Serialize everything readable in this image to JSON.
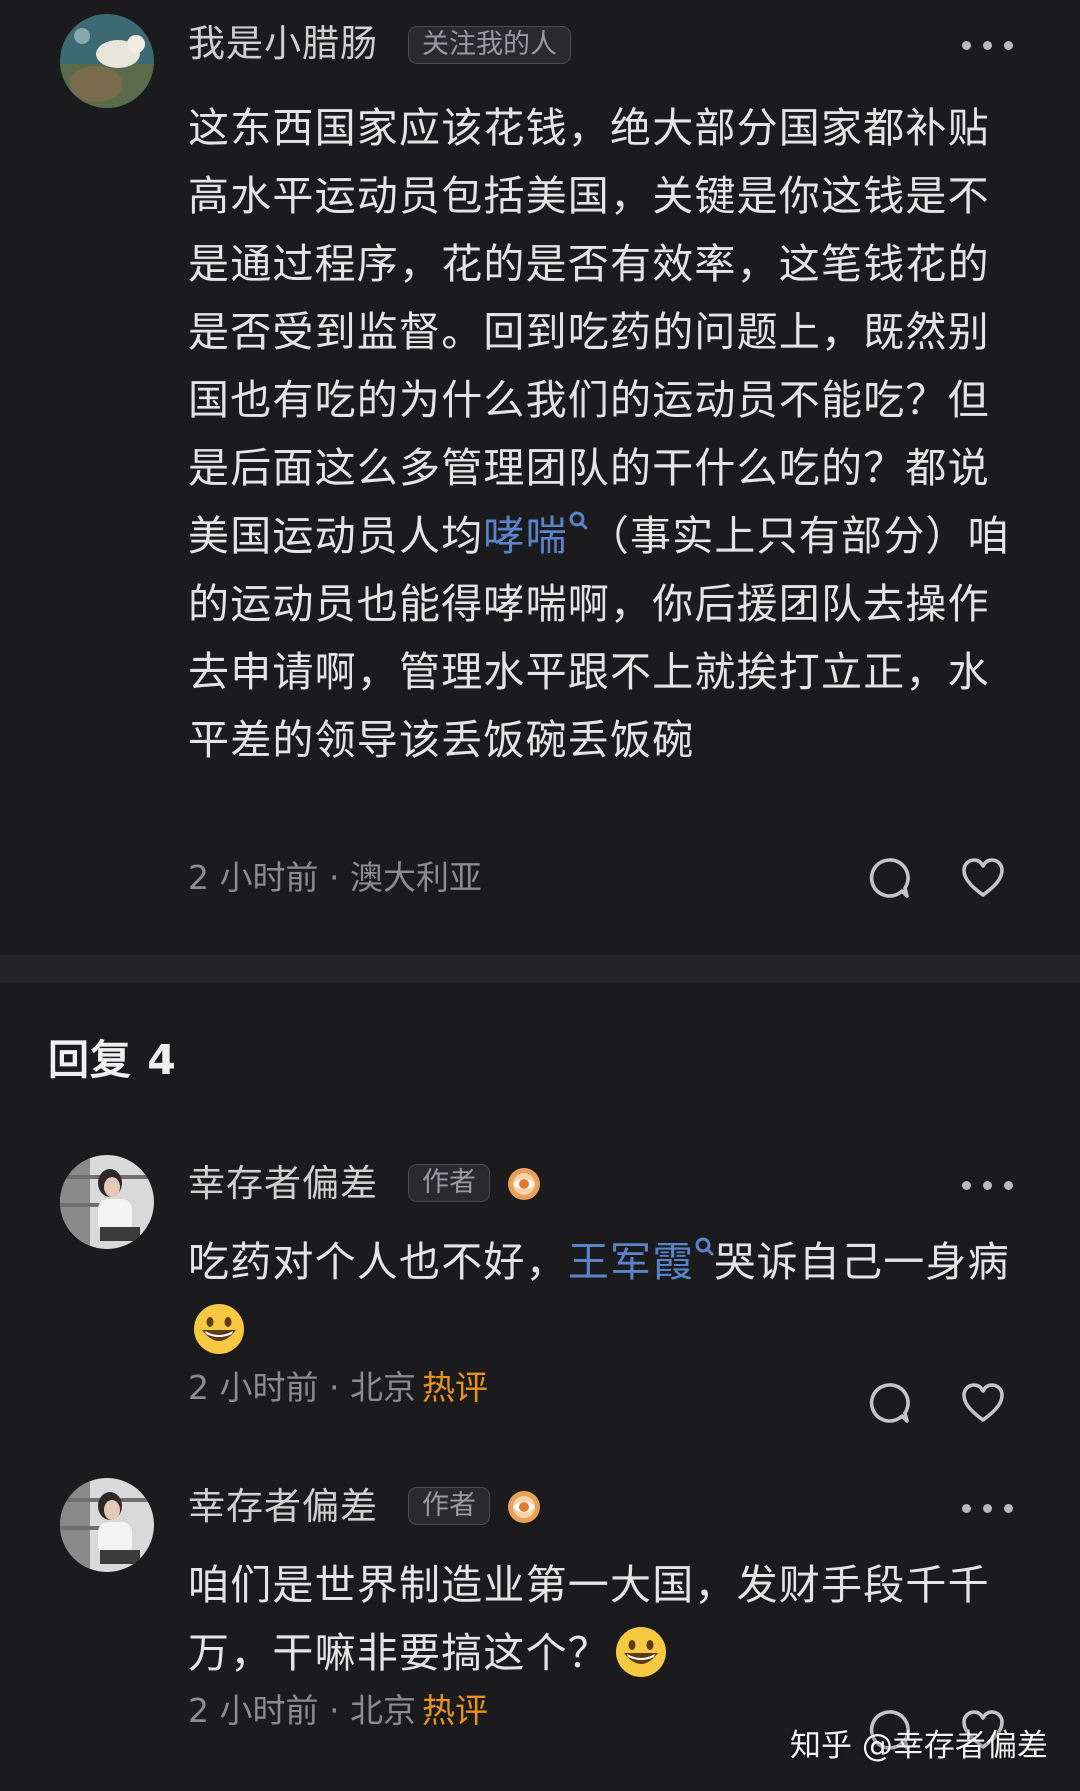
{
  "comments": [
    {
      "user": "我是小腊肠",
      "tag": "关注我的人",
      "body_pre": "这东西国家应该花钱，绝大部分国家都补贴高水平运动员包括美国，关键是你这钱是不是通过程序，花的是否有效率，这笔钱花的是否受到监督。回到吃药的问题上，既然别国也有吃的为什么我们的运动员不能吃？但是后面这么多管理团队的干什么吃的？都说美国运动员人均",
      "body_link": "哮喘",
      "body_post": "（事实上只有部分）咱的运动员也能得哮喘啊，你后援团队去操作去申请啊，管理水平跟不上就挨打立正，水平差的领导该丢饭碗丢饭碗",
      "meta": "2 小时前 · 澳大利亚"
    }
  ],
  "replies_section": {
    "title": "回复 4"
  },
  "replies": [
    {
      "user": "幸存者偏差",
      "tag": "作者",
      "body_pre": "吃药对个人也不好，",
      "body_link": "王军霞",
      "body_post": "哭诉自己一身病",
      "meta": "2 小时前 · 北京",
      "hot_label": "热评"
    },
    {
      "user": "幸存者偏差",
      "tag": "作者",
      "body_pre": "咱们是世界制造业第一大国，发财手段千千万，干嘛非要搞这个？",
      "meta": "2 小时前 · 北京",
      "hot_label": "热评"
    }
  ],
  "watermark": "知乎 @幸存者偏差",
  "icons": {
    "more": "more-dots-icon",
    "comment": "comment-bubble-icon",
    "like": "heart-icon",
    "badge": "creator-badge-icon",
    "search": "search-icon",
    "emoji": "grin-emoji-icon"
  },
  "colors": {
    "background": "#1b1b1e",
    "link": "#5a83c9",
    "hot": "#e8931f",
    "meta": "#8b8b90"
  }
}
